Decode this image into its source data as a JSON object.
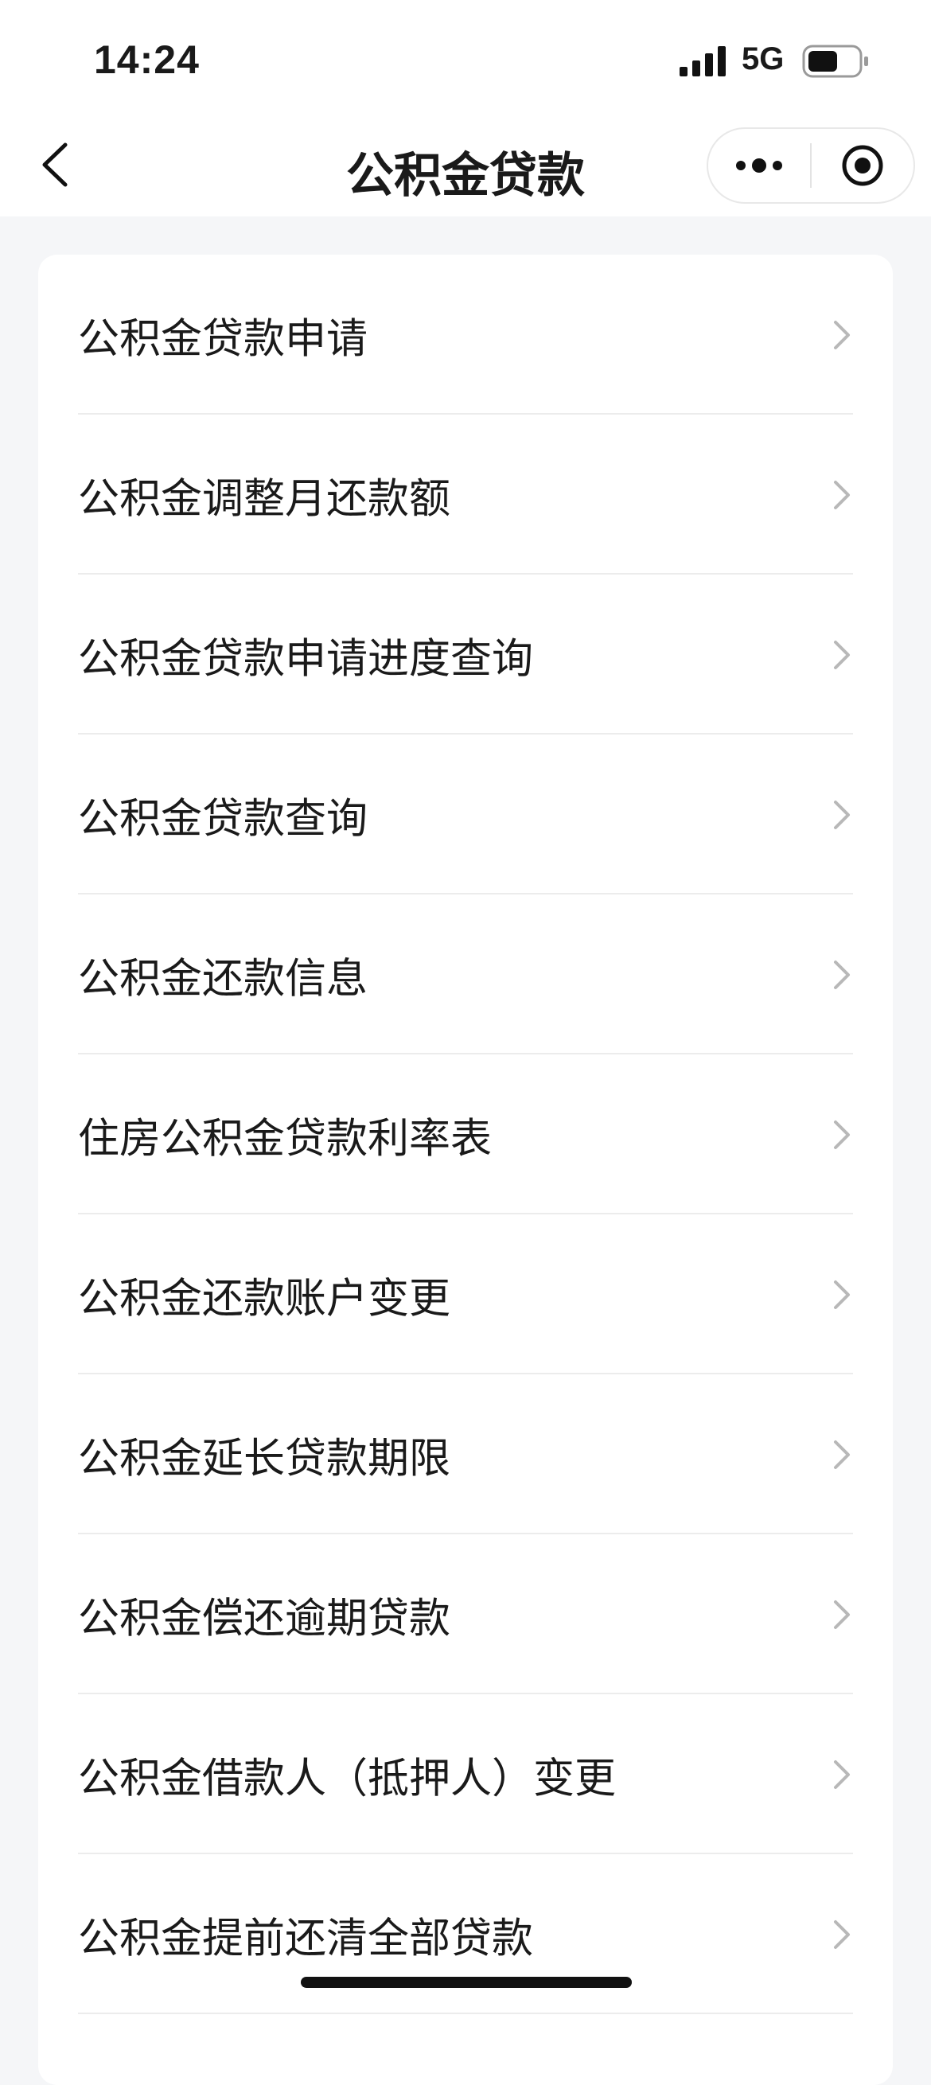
{
  "status_bar": {
    "time": "14:24",
    "network": "5G",
    "battery_level": 0.6
  },
  "nav": {
    "title": "公积金贷款",
    "back_icon": "chevron-left-icon",
    "more_icon": "more-dots-icon",
    "close_icon": "record-target-icon"
  },
  "menu": {
    "items": [
      {
        "label": "公积金贷款申请"
      },
      {
        "label": "公积金调整月还款额"
      },
      {
        "label": "公积金贷款申请进度查询"
      },
      {
        "label": "公积金贷款查询"
      },
      {
        "label": "公积金还款信息"
      },
      {
        "label": "住房公积金贷款利率表"
      },
      {
        "label": "公积金还款账户变更"
      },
      {
        "label": "公积金延长贷款期限"
      },
      {
        "label": "公积金偿还逾期贷款"
      },
      {
        "label": "公积金借款人（抵押人）变更"
      },
      {
        "label": "公积金提前还清全部贷款"
      }
    ]
  },
  "colors": {
    "background": "#f5f6f8",
    "card": "#ffffff",
    "text": "#1a1a1a",
    "chevron": "#b8b8b8",
    "separator": "#ececec"
  }
}
